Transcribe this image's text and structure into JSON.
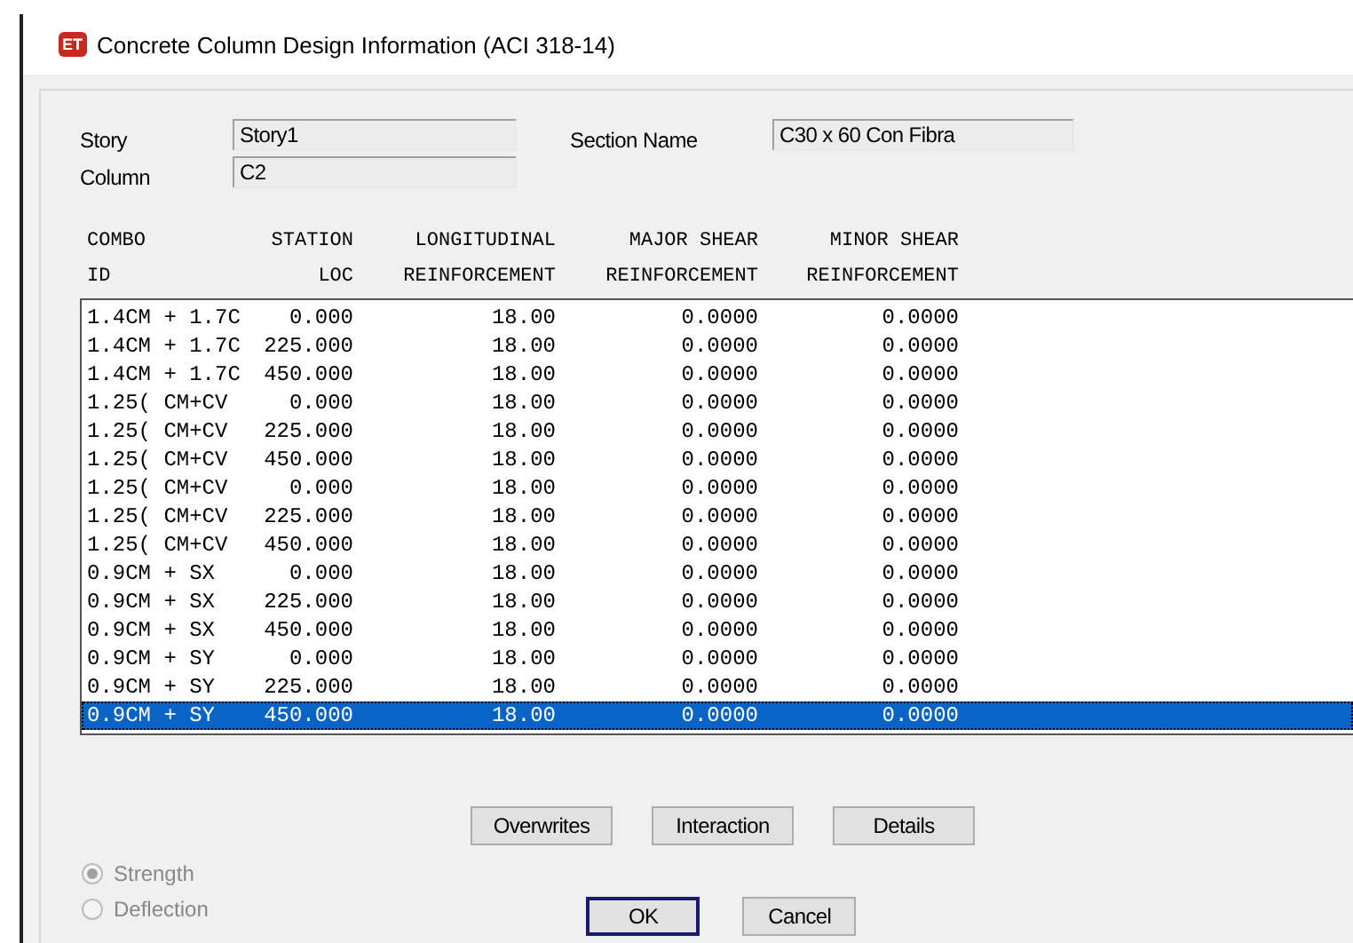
{
  "window": {
    "icon_text": "ET",
    "title": "Concrete Column Design Information (ACI 318-14)"
  },
  "fields": [
    {
      "label": "Story",
      "value": "Story1"
    },
    {
      "label": "Column",
      "value": "C2"
    }
  ],
  "section": {
    "label": "Section Name",
    "value": "C30 x 60 Con Fibra"
  },
  "table": {
    "header_rows": [
      [
        "COMBO",
        "STATION",
        "LONGITUDINAL",
        "MAJOR SHEAR",
        "MINOR SHEAR"
      ],
      [
        "ID",
        "LOC",
        "REINFORCEMENT",
        "REINFORCEMENT",
        "REINFORCEMENT"
      ]
    ],
    "rows": [
      {
        "cells": [
          "1.4CM + 1.7C",
          "0.000",
          "18.00",
          "0.0000",
          "0.0000"
        ],
        "selected": false
      },
      {
        "cells": [
          "1.4CM + 1.7C",
          "225.000",
          "18.00",
          "0.0000",
          "0.0000"
        ],
        "selected": false
      },
      {
        "cells": [
          "1.4CM + 1.7C",
          "450.000",
          "18.00",
          "0.0000",
          "0.0000"
        ],
        "selected": false
      },
      {
        "cells": [
          "1.25( CM+CV",
          "0.000",
          "18.00",
          "0.0000",
          "0.0000"
        ],
        "selected": false
      },
      {
        "cells": [
          "1.25( CM+CV",
          "225.000",
          "18.00",
          "0.0000",
          "0.0000"
        ],
        "selected": false
      },
      {
        "cells": [
          "1.25( CM+CV",
          "450.000",
          "18.00",
          "0.0000",
          "0.0000"
        ],
        "selected": false
      },
      {
        "cells": [
          "1.25( CM+CV",
          "0.000",
          "18.00",
          "0.0000",
          "0.0000"
        ],
        "selected": false
      },
      {
        "cells": [
          "1.25( CM+CV",
          "225.000",
          "18.00",
          "0.0000",
          "0.0000"
        ],
        "selected": false
      },
      {
        "cells": [
          "1.25( CM+CV",
          "450.000",
          "18.00",
          "0.0000",
          "0.0000"
        ],
        "selected": false
      },
      {
        "cells": [
          "0.9CM + SX",
          "0.000",
          "18.00",
          "0.0000",
          "0.0000"
        ],
        "selected": false
      },
      {
        "cells": [
          "0.9CM + SX",
          "225.000",
          "18.00",
          "0.0000",
          "0.0000"
        ],
        "selected": false
      },
      {
        "cells": [
          "0.9CM + SX",
          "450.000",
          "18.00",
          "0.0000",
          "0.0000"
        ],
        "selected": false
      },
      {
        "cells": [
          "0.9CM + SY",
          "0.000",
          "18.00",
          "0.0000",
          "0.0000"
        ],
        "selected": false
      },
      {
        "cells": [
          "0.9CM + SY",
          "225.000",
          "18.00",
          "0.0000",
          "0.0000"
        ],
        "selected": false
      },
      {
        "cells": [
          "0.9CM + SY",
          "450.000",
          "18.00",
          "0.0000",
          "0.0000"
        ],
        "selected": true
      }
    ]
  },
  "actions": [
    "Overwrites",
    "Interaction",
    "Details"
  ],
  "modes": [
    {
      "label": "Strength",
      "selected": true,
      "disabled": true
    },
    {
      "label": "Deflection",
      "selected": false,
      "disabled": true
    }
  ],
  "buttons": [
    {
      "label": "OK",
      "default": true
    },
    {
      "label": "Cancel",
      "default": false
    }
  ]
}
